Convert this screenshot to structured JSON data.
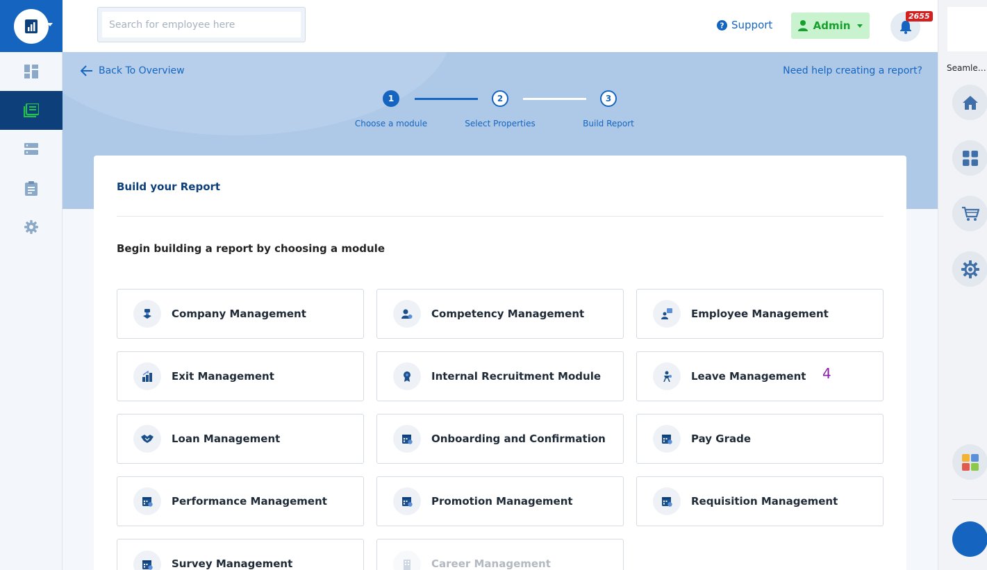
{
  "topbar": {
    "search_placeholder": "Search for employee here",
    "support_label": "Support",
    "admin_label": "Admin",
    "notifications_count": "2655"
  },
  "right_rail": {
    "label": "Seamless..."
  },
  "hero": {
    "back_label": "Back To Overview",
    "help_label": "Need help creating a report?",
    "steps": [
      {
        "number": "1",
        "label": "Choose a module",
        "state": "done"
      },
      {
        "number": "2",
        "label": "Select Properties",
        "state": "todo"
      },
      {
        "number": "3",
        "label": "Build Report",
        "state": "todo"
      }
    ]
  },
  "card": {
    "title": "Build your Report",
    "subtitle": "Begin building a report by choosing a module",
    "modules": [
      {
        "label": "Company Management",
        "icon": "company-icon"
      },
      {
        "label": "Competency Management",
        "icon": "competency-icon"
      },
      {
        "label": "Employee Management",
        "icon": "employee-icon"
      },
      {
        "label": "Exit Management",
        "icon": "exit-icon"
      },
      {
        "label": "Internal Recruitment Module",
        "icon": "recruitment-icon"
      },
      {
        "label": "Leave Management",
        "icon": "leave-icon"
      },
      {
        "label": "Loan Management",
        "icon": "handshake-icon"
      },
      {
        "label": "Onboarding and Confirmation",
        "icon": "calendar-icon"
      },
      {
        "label": "Pay Grade",
        "icon": "calendar-icon"
      },
      {
        "label": "Performance Management",
        "icon": "calendar-icon"
      },
      {
        "label": "Promotion Management",
        "icon": "calendar-icon"
      },
      {
        "label": "Requisition Management",
        "icon": "calendar-icon"
      },
      {
        "label": "Survey Management",
        "icon": "calendar-icon"
      },
      {
        "label": "Career Management",
        "icon": "building-icon",
        "disabled": true
      }
    ]
  },
  "annotation": "4",
  "colors": {
    "primary": "#1565c0",
    "dark_nav": "#0d3f7a",
    "hero_bg": "#adc9e7",
    "admin_green": "#17a02d",
    "badge_red": "#d51e1e"
  }
}
